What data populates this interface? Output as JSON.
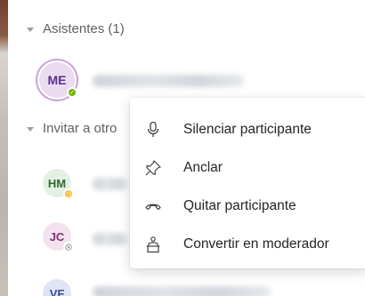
{
  "sections": {
    "attendees_label": "Asistentes (1)",
    "invite_label": "Invitar a otro"
  },
  "participants": [
    {
      "initials": "ME",
      "status": "available"
    },
    {
      "initials": "HM",
      "status": "away"
    },
    {
      "initials": "JC",
      "status": "offline"
    },
    {
      "initials": "VF",
      "status": "none"
    }
  ],
  "context_menu": {
    "items": [
      {
        "label": "Silenciar participante",
        "icon": "microphone-icon"
      },
      {
        "label": "Anclar",
        "icon": "pin-icon"
      },
      {
        "label": "Quitar participante",
        "icon": "hang-up-icon"
      },
      {
        "label": "Convertir en moderador",
        "icon": "presenter-icon"
      }
    ]
  },
  "colors": {
    "me_avatar_bg": "#eadcf0",
    "me_avatar_fg": "#5c2e91",
    "hm_avatar_bg": "#e3f1e4",
    "hm_avatar_fg": "#2e6b30",
    "jc_avatar_bg": "#f3e3ef",
    "jc_avatar_fg": "#8a2f6d",
    "vf_avatar_bg": "#e1e4f6",
    "vf_avatar_fg": "#3b4ba0",
    "status_available": "#6bb700",
    "status_away": "#f8b62b"
  }
}
